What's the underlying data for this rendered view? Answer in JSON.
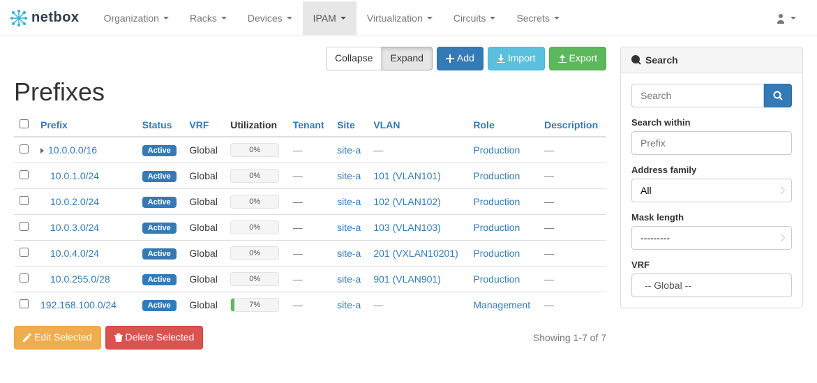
{
  "brand": {
    "name": "netbox"
  },
  "nav": [
    {
      "label": "Organization"
    },
    {
      "label": "Racks"
    },
    {
      "label": "Devices"
    },
    {
      "label": "IPAM",
      "active": true
    },
    {
      "label": "Virtualization"
    },
    {
      "label": "Circuits"
    },
    {
      "label": "Secrets"
    }
  ],
  "actions": {
    "collapse": "Collapse",
    "expand": "Expand",
    "add": "Add",
    "import": "Import",
    "export": "Export"
  },
  "page": {
    "title": "Prefixes"
  },
  "table": {
    "headers": {
      "prefix": "Prefix",
      "status": "Status",
      "vrf": "VRF",
      "utilization": "Utilization",
      "tenant": "Tenant",
      "site": "Site",
      "vlan": "VLAN",
      "role": "Role",
      "description": "Description"
    },
    "rows": [
      {
        "prefix": "10.0.0.0/16",
        "depth": 0,
        "expandable": true,
        "status": "Active",
        "vrf": "Global",
        "util": "0%",
        "util_pct": 0,
        "tenant": "—",
        "site": "site-a",
        "vlan": "—",
        "role": "Production",
        "description": "—"
      },
      {
        "prefix": "10.0.1.0/24",
        "depth": 1,
        "status": "Active",
        "vrf": "Global",
        "util": "0%",
        "util_pct": 0,
        "tenant": "—",
        "site": "site-a",
        "vlan": "101 (VLAN101)",
        "role": "Production",
        "description": "—"
      },
      {
        "prefix": "10.0.2.0/24",
        "depth": 1,
        "status": "Active",
        "vrf": "Global",
        "util": "0%",
        "util_pct": 0,
        "tenant": "—",
        "site": "site-a",
        "vlan": "102 (VLAN102)",
        "role": "Production",
        "description": "—"
      },
      {
        "prefix": "10.0.3.0/24",
        "depth": 1,
        "status": "Active",
        "vrf": "Global",
        "util": "0%",
        "util_pct": 0,
        "tenant": "—",
        "site": "site-a",
        "vlan": "103 (VLAN103)",
        "role": "Production",
        "description": "—"
      },
      {
        "prefix": "10.0.4.0/24",
        "depth": 1,
        "status": "Active",
        "vrf": "Global",
        "util": "0%",
        "util_pct": 0,
        "tenant": "—",
        "site": "site-a",
        "vlan": "201 (VXLAN10201)",
        "role": "Production",
        "description": "—"
      },
      {
        "prefix": "10.0.255.0/28",
        "depth": 1,
        "status": "Active",
        "vrf": "Global",
        "util": "0%",
        "util_pct": 0,
        "tenant": "—",
        "site": "site-a",
        "vlan": "901 (VLAN901)",
        "role": "Production",
        "description": "—"
      },
      {
        "prefix": "192.168.100.0/24",
        "depth": 0,
        "status": "Active",
        "vrf": "Global",
        "util": "7%",
        "util_pct": 7,
        "tenant": "—",
        "site": "site-a",
        "vlan": "—",
        "role": "Management",
        "description": "—"
      }
    ],
    "count_text": "Showing 1-7 of 7"
  },
  "bulk": {
    "edit": "Edit Selected",
    "delete": "Delete Selected"
  },
  "sidebar": {
    "heading": "Search",
    "search_placeholder": "Search",
    "within_label": "Search within",
    "within_placeholder": "Prefix",
    "af_label": "Address family",
    "af_value": "All",
    "mask_label": "Mask length",
    "mask_value": "---------",
    "vrf_label": "VRF",
    "vrf_item": "-- Global --"
  }
}
